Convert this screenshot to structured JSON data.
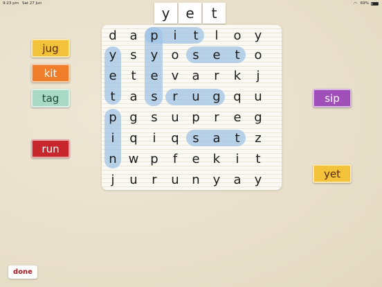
{
  "status_bar": {
    "time": "9:23 pm",
    "date": "Sat 27 Jun",
    "battery": "69%"
  },
  "target_word": [
    "y",
    "e",
    "t"
  ],
  "grid": [
    [
      "d",
      "a",
      "p",
      "i",
      "t",
      "l",
      "o",
      "y"
    ],
    [
      "y",
      "s",
      "y",
      "o",
      "s",
      "e",
      "t",
      "o"
    ],
    [
      "e",
      "t",
      "e",
      "v",
      "a",
      "r",
      "k",
      "j"
    ],
    [
      "t",
      "a",
      "s",
      "r",
      "u",
      "g",
      "q",
      "u"
    ],
    [
      "p",
      "g",
      "s",
      "u",
      "p",
      "r",
      "e",
      "g"
    ],
    [
      "i",
      "q",
      "i",
      "q",
      "s",
      "a",
      "t",
      "z"
    ],
    [
      "n",
      "w",
      "p",
      "f",
      "e",
      "k",
      "i",
      "t"
    ],
    [
      "j",
      "u",
      "r",
      "u",
      "n",
      "y",
      "a",
      "y"
    ]
  ],
  "words": [
    {
      "label": "jug",
      "color": "#f2c23a",
      "text_color": "#5a2a00"
    },
    {
      "label": "kit",
      "color": "#f07d2a",
      "text_color": "#ffffff"
    },
    {
      "label": "tag",
      "color": "#a9dac6",
      "text_color": "#1e4a3c"
    },
    {
      "label": "run",
      "color": "#c8262d",
      "text_color": "#ffffff"
    },
    {
      "label": "sip",
      "color": "#a04fb8",
      "text_color": "#ffffff"
    },
    {
      "label": "yet",
      "color": "#f2c23a",
      "text_color": "#5a2a00"
    }
  ],
  "done_label": "done"
}
